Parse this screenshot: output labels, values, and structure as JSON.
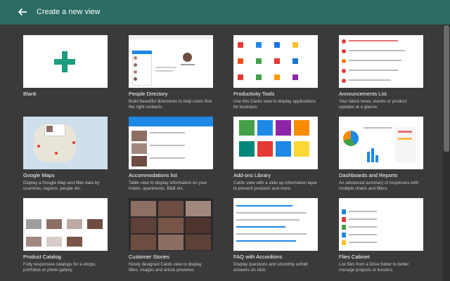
{
  "header": {
    "title": "Create a new view",
    "back_icon": "arrow-left-icon"
  },
  "colors": {
    "header_bg": "#2a6b63",
    "page_bg": "#3a3a3a",
    "accent": "#1d9c7f"
  },
  "cards": [
    {
      "title": "Blank",
      "desc": ""
    },
    {
      "title": "People Directory",
      "desc": "Build beautiful directories to help users find the right contacts."
    },
    {
      "title": "Productivity Tools",
      "desc": "Use this Cards view to display applications for business."
    },
    {
      "title": "Announcements List",
      "desc": "Your latest news, events or product updates at a glance."
    },
    {
      "title": "Google Maps",
      "desc": "Display a Google Map and filter data by countries, regions, people etc."
    },
    {
      "title": "Accommodations list",
      "desc": "Table view to display information on your hotels, apartments, B&B etc."
    },
    {
      "title": "Add-ons Library",
      "desc": "Cards view with a slide up information layer to present products and more."
    },
    {
      "title": "Dashboards and Reports",
      "desc": "An advanced summary of responses with multiple charts and filters."
    },
    {
      "title": "Product Catalog",
      "desc": "Fully responsive catalogs for e-shops, portfolios or photo gallery."
    },
    {
      "title": "Customer Stories",
      "desc": "Nicely designed Cards view to display titles, images and article previews."
    },
    {
      "title": "FAQ with Accordions",
      "desc": "Display questions and smoothly unfold answers on click."
    },
    {
      "title": "Files Cabinet",
      "desc": "List files from a Drive folder to better manage projects or lessons."
    }
  ]
}
